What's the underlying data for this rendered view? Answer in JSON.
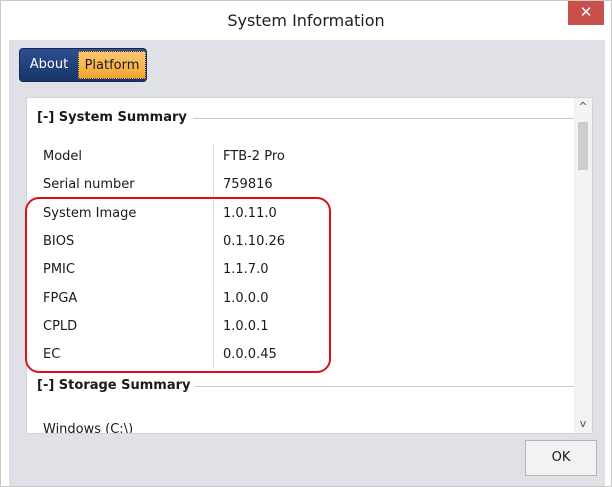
{
  "window": {
    "title": "System Information",
    "close_glyph": "✕"
  },
  "tabs": [
    {
      "label": "About",
      "selected": false
    },
    {
      "label": "Platform",
      "selected": true
    }
  ],
  "sections": {
    "system_summary": {
      "header": "[-] System Summary",
      "rows": [
        {
          "label": "Model",
          "value": "FTB-2 Pro"
        },
        {
          "label": "Serial number",
          "value": "759816"
        },
        {
          "label": "System Image",
          "value": "1.0.11.0"
        },
        {
          "label": "BIOS",
          "value": "0.1.10.26"
        },
        {
          "label": "PMIC",
          "value": "1.1.7.0"
        },
        {
          "label": "FPGA",
          "value": "1.0.0.0"
        },
        {
          "label": "CPLD",
          "value": "1.0.0.1"
        },
        {
          "label": "EC",
          "value": "0.0.0.45"
        }
      ]
    },
    "storage_summary": {
      "header": "[-] Storage Summary",
      "rows": [
        {
          "label": "Windows (C:\\)",
          "value": ""
        }
      ]
    }
  },
  "scrollbar": {
    "up_glyph": "^",
    "down_glyph": "v"
  },
  "footer": {
    "ok_label": "OK"
  },
  "colors": {
    "highlight_outline": "#d8111d",
    "tab_group": "#17346a",
    "tab_selected": "#f5a531",
    "close_button": "#c7504c"
  }
}
